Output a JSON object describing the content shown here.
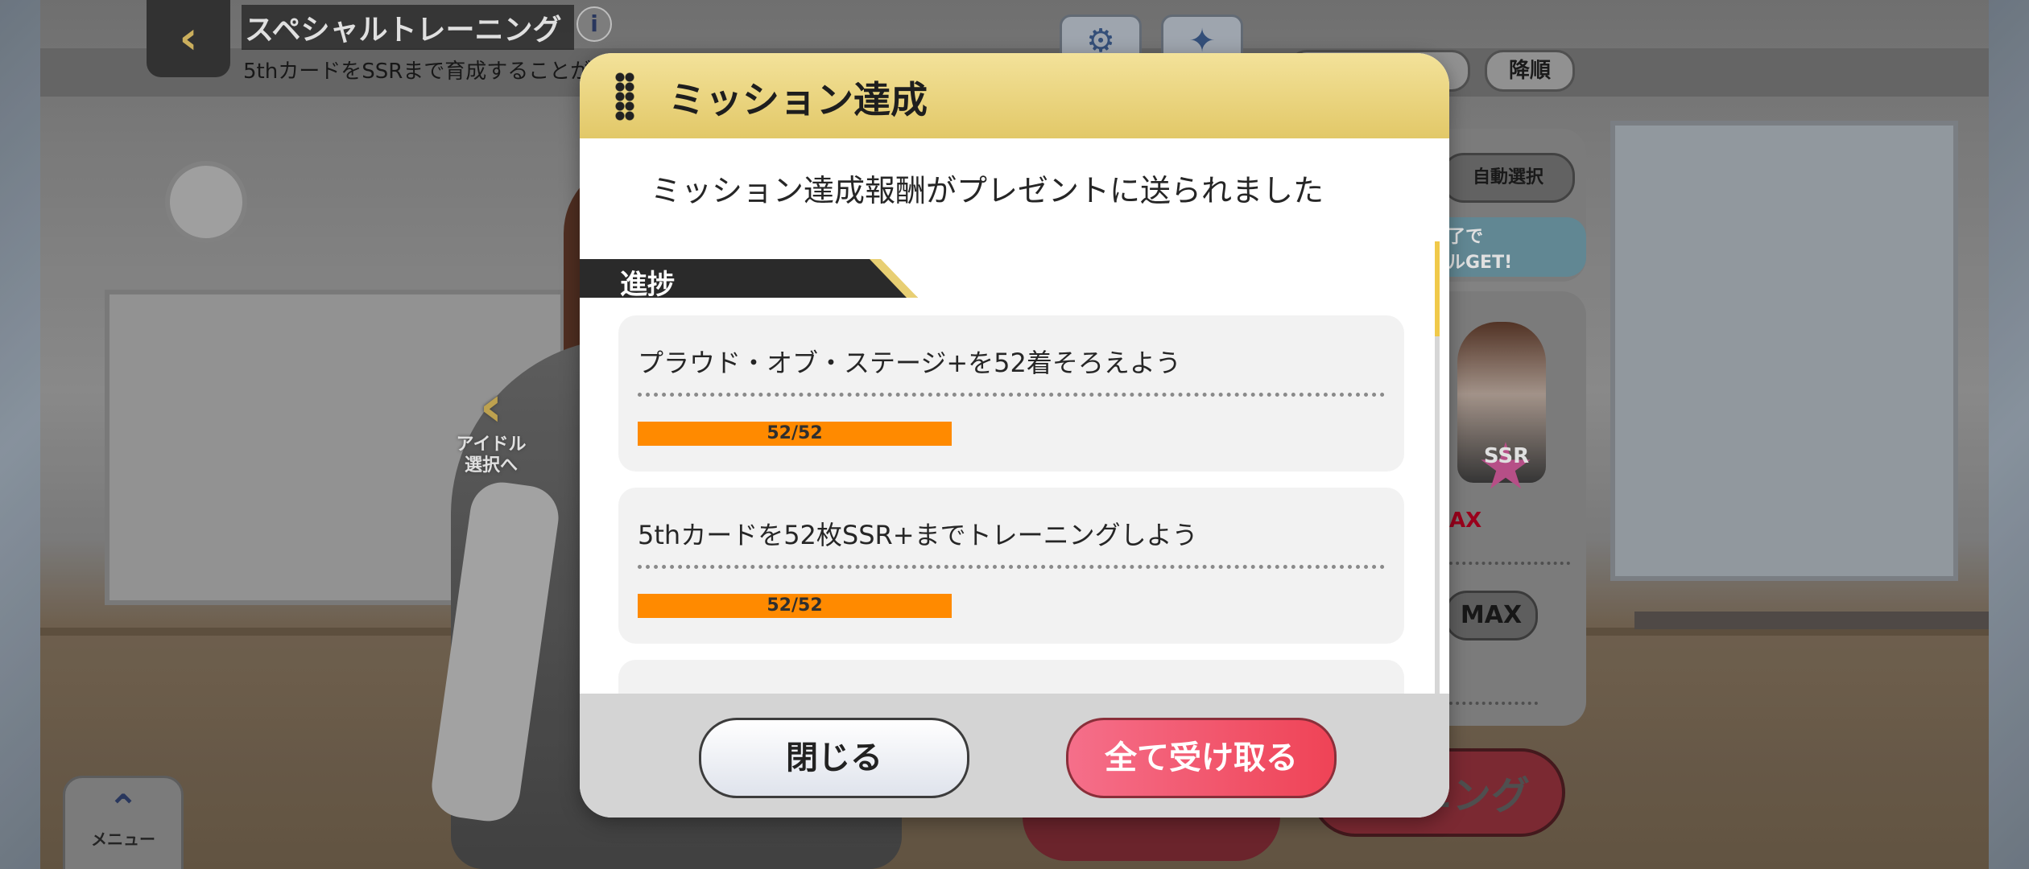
{
  "header": {
    "title": "スペシャルトレーニング",
    "subtitle": "5thカードをSSRまで育成することが",
    "sort_label": "降順"
  },
  "right_panel": {
    "auto_select_label": "自動選択",
    "banner_text": "了で\nルGET!",
    "rarity_label": "SSR",
    "max_red": "AX",
    "max_pill": "MAX",
    "training_button": "ニング"
  },
  "left_nav": {
    "idol_select_label": "アイドル\n選択へ",
    "menu_label": "メニュー"
  },
  "dialog": {
    "title": "ミッション達成",
    "message": "ミッション達成報酬がプレゼントに送られました",
    "section_label": "進捗",
    "missions": [
      {
        "text": "プラウド・オブ・ステージ+を52着そろえよう",
        "progress": "52/52",
        "current": 52,
        "total": 52
      },
      {
        "text": "5thカードを52枚SSR+までトレーニングしよう",
        "progress": "52/52",
        "current": 52,
        "total": 52
      }
    ],
    "close_label": "閉じる",
    "receive_all_label": "全て受け取る"
  },
  "colors": {
    "accent_gold": "#e2c868",
    "progress_fill": "#ff8a00",
    "receive_button": "#ef4356"
  }
}
